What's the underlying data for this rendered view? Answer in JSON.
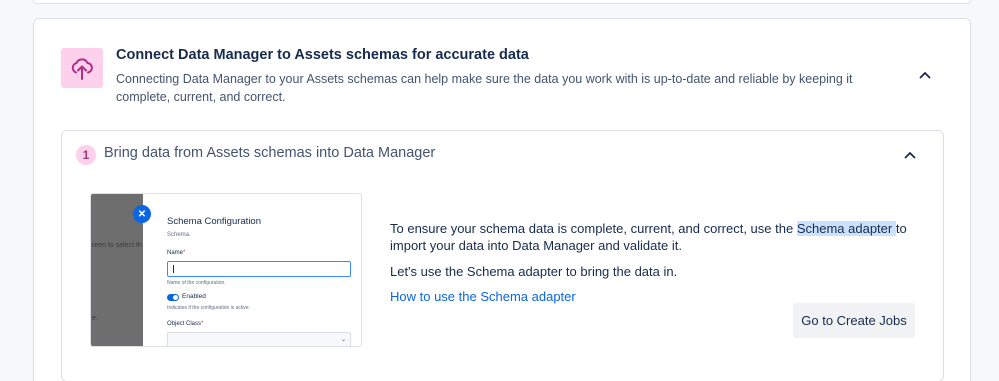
{
  "hero": {
    "title": "Connect Data Manager to Assets schemas for accurate data",
    "description": "Connecting Data Manager to your Assets schemas can help make sure the data you work with is up-to-date and reliable by keeping it complete, current, and correct.",
    "icon": "cloud-upload-icon"
  },
  "step": {
    "number": "1",
    "title": "Bring data from Assets schemas into Data Manager",
    "paragraph_before": "To ensure your schema data is complete, current, and correct, use the ",
    "highlight": "Schema adapter ",
    "paragraph_after": "to import your data into Data Manager and validate it.",
    "paragraph2": "Let's use the Schema adapter to bring the data in.",
    "link": "How to use the Schema adapter",
    "button": "Go to Create Jobs"
  },
  "preview": {
    "dark_text_1": "reen to select th",
    "dark_text_2": "e.",
    "title": "Schema Configuration",
    "subtitle": "Schema.",
    "name_label": "Name",
    "required_mark": "*",
    "name_help": "Name of the configuration.",
    "toggle_label": "Enabled",
    "toggle_help": "Indicates if the configuration is active.",
    "object_class_label": "Object Class"
  },
  "colors": {
    "accent_pink": "#fdd0ec",
    "link_blue": "#0c66e4",
    "highlight": "#cce0ff"
  }
}
